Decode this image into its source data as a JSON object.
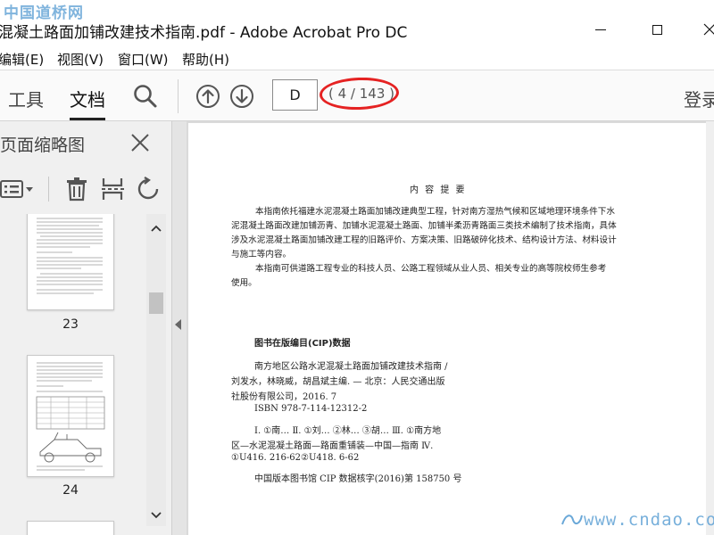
{
  "watermark": {
    "top": "中国道桥网",
    "bottom": "www.cndao.com"
  },
  "window": {
    "title": "混凝土路面加铺改建技术指南.pdf - Adobe Acrobat Pro DC"
  },
  "menu": [
    {
      "label": "编辑(E)"
    },
    {
      "label": "视图(V)"
    },
    {
      "label": "窗口(W)"
    },
    {
      "label": "帮助(H)"
    }
  ],
  "toolbar": {
    "tools_label": "工具",
    "docs_label": "文档",
    "page_input": "D",
    "page_count": "( 4 / 143 )",
    "signin_label": "登录"
  },
  "left_panel": {
    "title": "页面缩略图",
    "thumbnails": [
      {
        "page_label": "23"
      },
      {
        "page_label": "24"
      }
    ]
  },
  "document": {
    "heading": "内 容 提 要",
    "summary_lines": [
      "本指南依托福建水泥混凝土路面加铺改建典型工程，针对南方湿热气候和区域地理环境条件下水",
      "泥混凝土路面改建加铺沥青、加铺水泥混凝土路面、加铺半柔沥青路面三类技术编制了技术指南，具体",
      "涉及水泥混凝土路面加铺改建工程的旧路评价、方案决策、旧路破碎化技术、结构设计方法、材料设计",
      "与施工等内容。",
      "本指南可供道路工程专业的科技人员、公路工程领域从业人员、相关专业的高等院校师生参考",
      "使用。"
    ],
    "cip_title": "图书在版编目(CIP)数据",
    "cip_lines": [
      "南方地区公路水泥混凝土路面加铺改建技术指南 /",
      "刘发水，林晓威，胡昌斌主编. — 北京：人民交通出版",
      "社股份有限公司，2016. 7",
      "ISBN 978-7-114-12312-2",
      "Ⅰ. ①南… Ⅱ. ①刘… ②林… ③胡… Ⅲ. ①南方地",
      "区—水泥混凝土路面—路面重铺装—中国—指南 Ⅳ.",
      "①U416. 216-62②U418. 6-62",
      "中国版本图书馆 CIP 数据核字(2016)第 158750 号"
    ]
  },
  "colors": {
    "annotation_oval": "#e52222",
    "watermark": "#6aa8d8"
  }
}
